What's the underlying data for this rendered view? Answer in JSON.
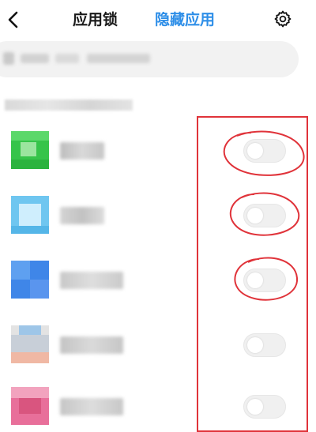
{
  "header": {
    "tabs": [
      {
        "label": "应用锁",
        "active": false
      },
      {
        "label": "隐藏应用",
        "active": true
      }
    ],
    "active_color": "#2f8fe8"
  },
  "search": {
    "placeholder": "",
    "blurred": true
  },
  "section": {
    "label": ""
  },
  "apps": [
    {
      "name": "",
      "icon_color": "#36c44a",
      "hidden": false,
      "circled": true
    },
    {
      "name": "",
      "icon_color": "#6fc6f0",
      "hidden": false,
      "circled": true
    },
    {
      "name": "",
      "icon_color": "#3f86e8",
      "hidden": false,
      "circled": true
    },
    {
      "name": "",
      "icon_color": "#f0b8a4",
      "hidden": false,
      "circled": false
    },
    {
      "name": "",
      "icon_color": "#e86f9a",
      "hidden": false,
      "circled": false
    }
  ],
  "annotation": {
    "stroke_color": "#e0333a"
  }
}
